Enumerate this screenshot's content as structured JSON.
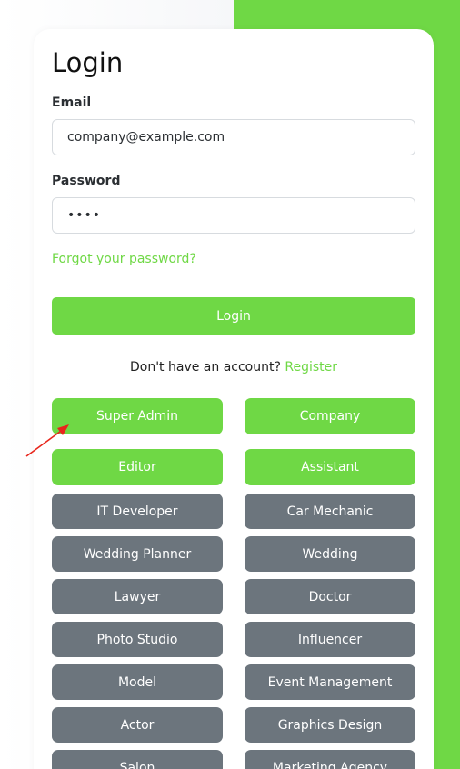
{
  "login": {
    "title": "Login",
    "email_label": "Email",
    "email_value": "company@example.com",
    "password_label": "Password",
    "password_value": "1234",
    "forgot_link": "Forgot your password?",
    "login_button": "Login",
    "no_account_text": "Don't have an account?",
    "register_link": "Register"
  },
  "roles": [
    {
      "label": "Super Admin",
      "style": "green"
    },
    {
      "label": "Company",
      "style": "green"
    },
    {
      "label": "Editor",
      "style": "green"
    },
    {
      "label": "Assistant",
      "style": "green"
    },
    {
      "label": "IT Developer",
      "style": "gray"
    },
    {
      "label": "Car Mechanic",
      "style": "gray"
    },
    {
      "label": "Wedding Planner",
      "style": "gray"
    },
    {
      "label": "Wedding",
      "style": "gray"
    },
    {
      "label": "Lawyer",
      "style": "gray"
    },
    {
      "label": "Doctor",
      "style": "gray"
    },
    {
      "label": "Photo Studio",
      "style": "gray"
    },
    {
      "label": "Influencer",
      "style": "gray"
    },
    {
      "label": "Model",
      "style": "gray"
    },
    {
      "label": "Event Management",
      "style": "gray"
    },
    {
      "label": "Actor",
      "style": "gray"
    },
    {
      "label": "Graphics Design",
      "style": "gray"
    },
    {
      "label": "Salon",
      "style": "gray"
    },
    {
      "label": "Marketing Agency",
      "style": "gray"
    }
  ],
  "colors": {
    "accent": "#6fd845",
    "role_gray": "#6c757d",
    "annotation_arrow": "#e8261c"
  }
}
